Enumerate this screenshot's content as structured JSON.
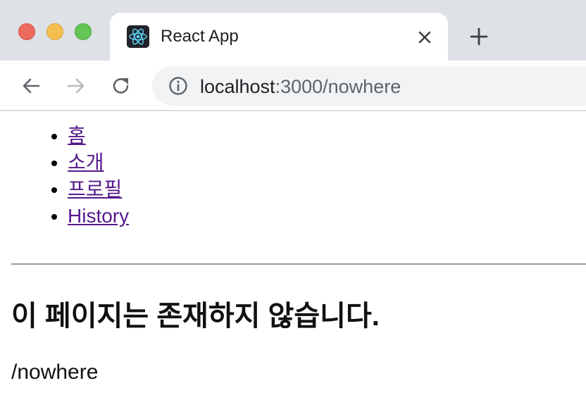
{
  "window": {
    "tab": {
      "title": "React App",
      "favicon": "react-logo-icon",
      "close": "close-icon"
    },
    "new_tab": "plus-icon"
  },
  "toolbar": {
    "back": "back-arrow-icon",
    "forward": "forward-arrow-icon",
    "reload": "reload-icon",
    "info": "info-icon",
    "url_host": "localhost",
    "url_rest": ":3000/nowhere"
  },
  "page": {
    "nav": [
      {
        "label": "홈"
      },
      {
        "label": "소개"
      },
      {
        "label": "프로필"
      },
      {
        "label": "History"
      }
    ],
    "title": "이 페이지는 존재하지 않습니다.",
    "path": "/nowhere"
  },
  "colors": {
    "tabstrip_bg": "#dee1e6",
    "omnibox_bg": "#f1f3f4",
    "link_visited": "#551a8b",
    "traffic_red": "#ed6a5e",
    "traffic_yellow": "#f5bf4f",
    "traffic_green": "#62c554"
  }
}
